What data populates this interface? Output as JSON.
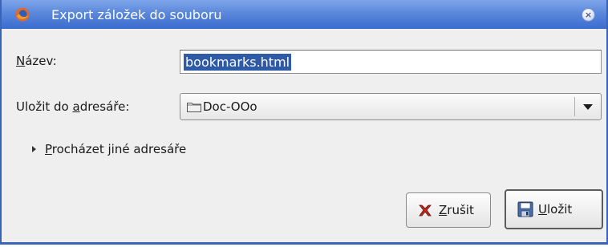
{
  "window": {
    "title": "Export záložek do souboru",
    "titlebar_color": "#5b88db"
  },
  "form": {
    "name_label_mnemonic": "N",
    "name_label_rest": "ázev:",
    "name_value": "bookmarks.html",
    "folder_label_pre": "Uložit do ",
    "folder_label_mnemonic": "a",
    "folder_label_rest": "dresáře:",
    "folder_value": "Doc-OOo",
    "browse_mnemonic": "P",
    "browse_rest": "rocházet jiné adresáře"
  },
  "buttons": {
    "cancel_mnemonic": "Z",
    "cancel_rest": "rušit",
    "save_mnemonic": "U",
    "save_rest": "ložit"
  },
  "icons": {
    "app": "firefox-icon",
    "close": "close-icon",
    "folder": "folder-icon",
    "cancel": "cancel-x-icon",
    "save": "floppy-disk-icon"
  }
}
